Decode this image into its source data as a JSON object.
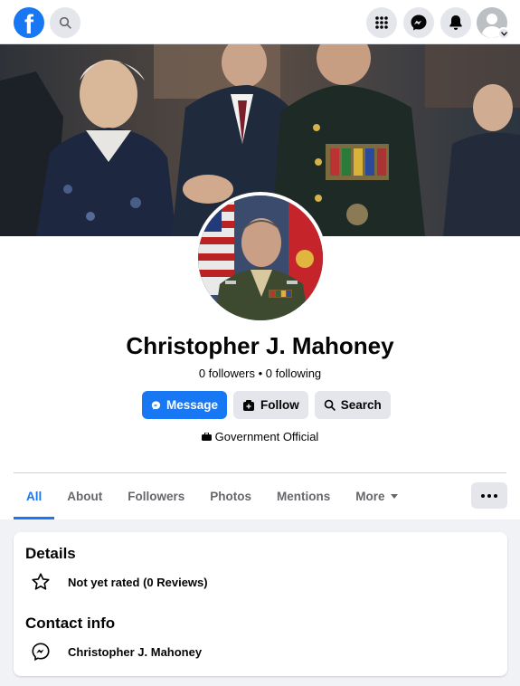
{
  "topbar": {
    "logo_letter": "f",
    "icons": [
      "facebook-logo",
      "search-icon",
      "menu-grid-icon",
      "messenger-icon",
      "bell-icon",
      "account-avatar"
    ]
  },
  "profile": {
    "name": "Christopher J. Mahoney",
    "stats": "0 followers • 0 following",
    "category": "Government Official"
  },
  "actions": {
    "message_label": "Message",
    "follow_label": "Follow",
    "search_label": "Search"
  },
  "tabs": [
    {
      "label": "All",
      "active": true
    },
    {
      "label": "About",
      "active": false
    },
    {
      "label": "Followers",
      "active": false
    },
    {
      "label": "Photos",
      "active": false
    },
    {
      "label": "Mentions",
      "active": false
    },
    {
      "label": "More",
      "active": false
    }
  ],
  "details": {
    "heading": "Details",
    "rating": "Not yet rated (0 Reviews)",
    "contact_heading": "Contact info",
    "contact_messenger": "Christopher J. Mahoney"
  },
  "colors": {
    "brand": "#1877f2",
    "button_gray": "#e4e6eb",
    "page_bg": "#f0f2f5"
  }
}
